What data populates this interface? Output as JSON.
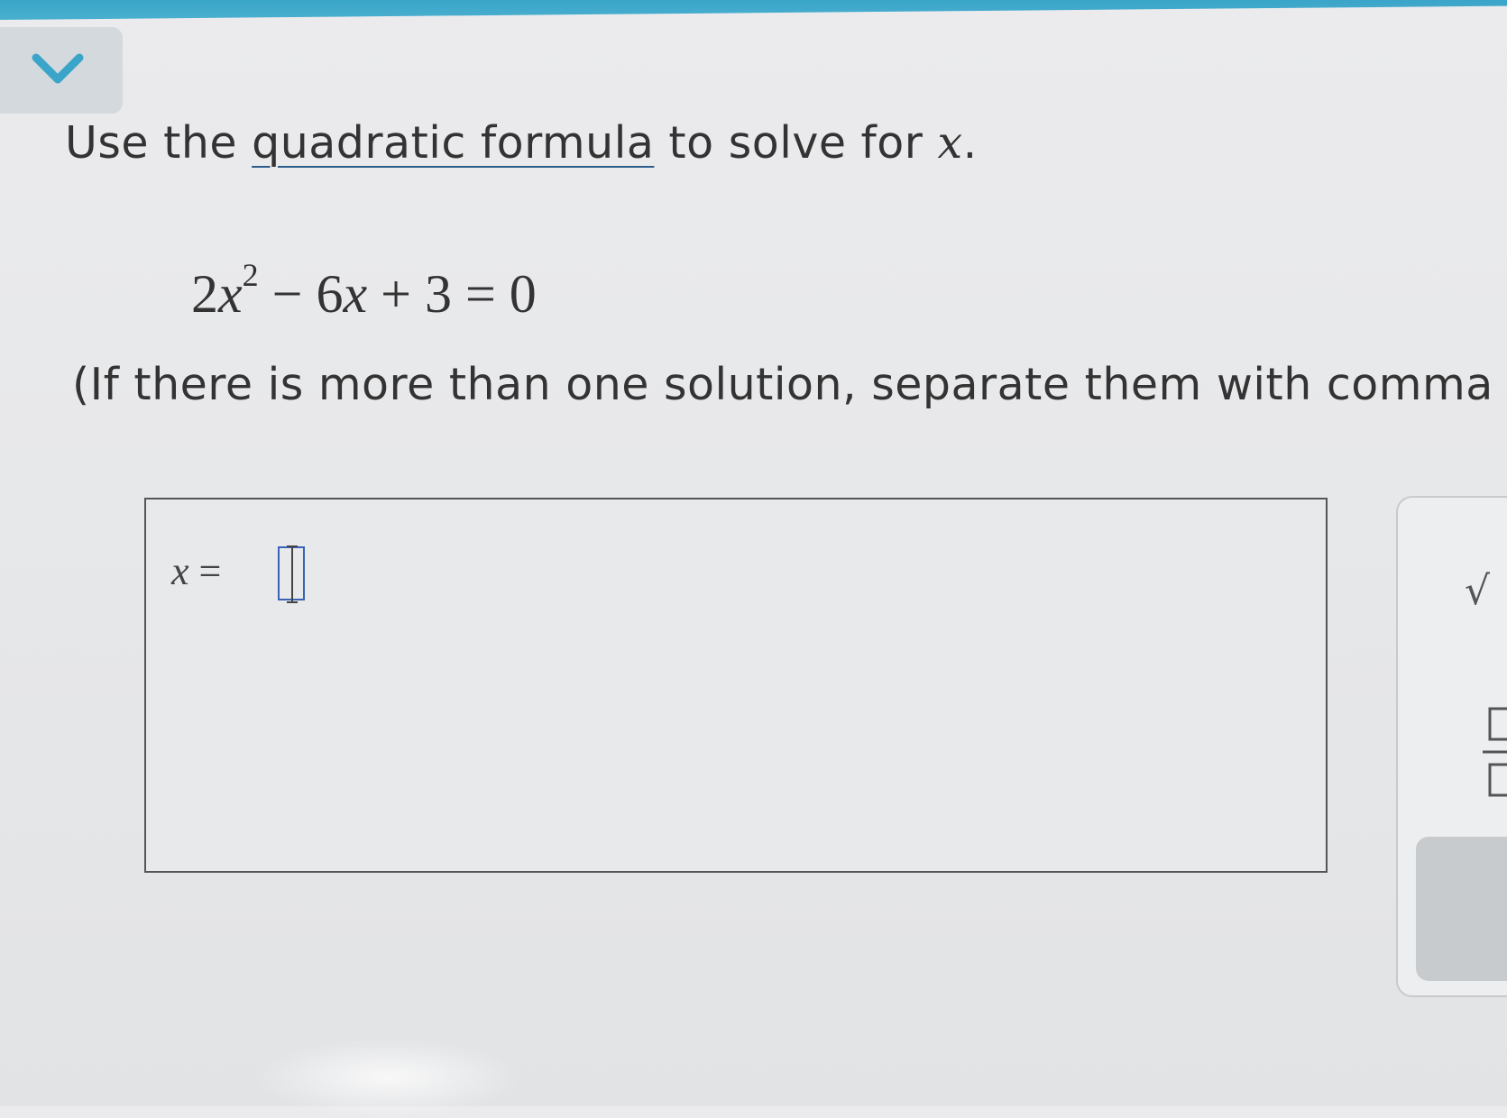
{
  "header": {
    "accent_color": "#3aa5c9",
    "collapse_icon": "chevron-down-icon"
  },
  "question": {
    "prompt_before": "Use the ",
    "prompt_link": "quadratic formula",
    "prompt_after": " to solve for ",
    "prompt_var": "x",
    "prompt_end": "."
  },
  "equation": {
    "coef": "2",
    "var1": "x",
    "exponent": "2",
    "minus_term": " − 6",
    "var2": "x",
    "rest": " + 3 = 0"
  },
  "instruction": "(If there is more than one solution, separate them with comma",
  "answer": {
    "var": "x",
    "equals": " = ",
    "value": ""
  },
  "toolbar": {
    "sqrt_label": "√",
    "sqrt_icon": "square-root-icon",
    "fraction_icon": "fraction-icon"
  }
}
